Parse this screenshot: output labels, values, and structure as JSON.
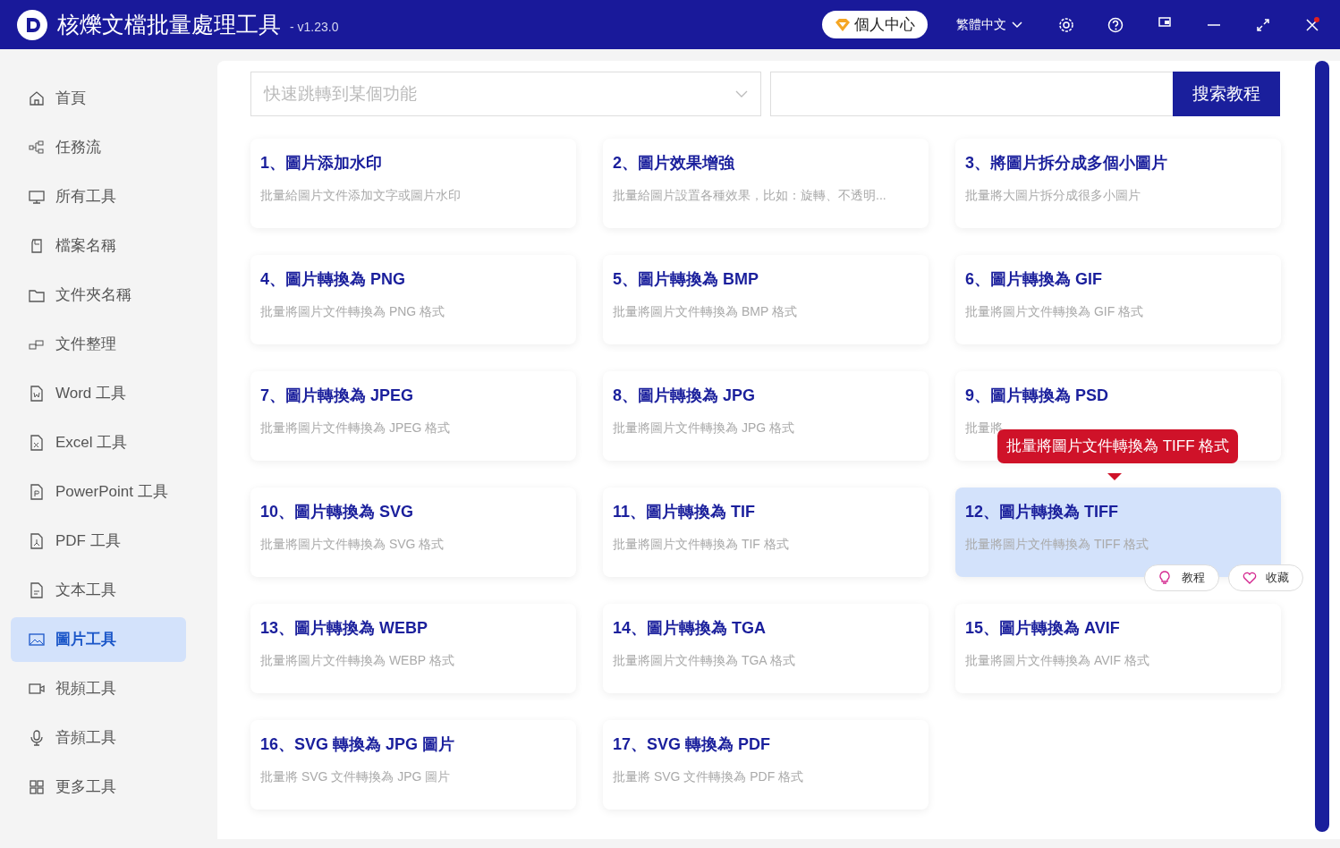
{
  "app": {
    "title": "核爍文檔批量處理工具",
    "version": "- v1.23.0"
  },
  "header": {
    "account_button": "個人中心",
    "language": "繁體中文"
  },
  "sidebar": {
    "items": [
      {
        "label": "首頁",
        "selected": false
      },
      {
        "label": "任務流",
        "selected": false
      },
      {
        "label": "所有工具",
        "selected": false
      },
      {
        "label": "檔案名稱",
        "selected": false
      },
      {
        "label": "文件夾名稱",
        "selected": false
      },
      {
        "label": "文件整理",
        "selected": false
      },
      {
        "label": "Word 工具",
        "selected": false
      },
      {
        "label": "Excel 工具",
        "selected": false
      },
      {
        "label": "PowerPoint 工具",
        "selected": false
      },
      {
        "label": "PDF 工具",
        "selected": false
      },
      {
        "label": "文本工具",
        "selected": false
      },
      {
        "label": "圖片工具",
        "selected": true
      },
      {
        "label": "視頻工具",
        "selected": false
      },
      {
        "label": "音頻工具",
        "selected": false
      },
      {
        "label": "更多工具",
        "selected": false
      }
    ]
  },
  "search": {
    "placeholder": "快速跳轉到某個功能",
    "button": "搜索教程"
  },
  "tools": [
    {
      "title": "1、圖片添加水印",
      "description": "批量給圖片文件添加文字或圖片水印",
      "selected": false
    },
    {
      "title": "2、圖片效果增強",
      "description": "批量給圖片設置各種效果，比如：旋轉、不透明...",
      "selected": false
    },
    {
      "title": "3、將圖片拆分成多個小圖片",
      "description": "批量將大圖片拆分成很多小圖片",
      "selected": false
    },
    {
      "title": "4、圖片轉換為 PNG",
      "description": "批量將圖片文件轉換為 PNG 格式",
      "selected": false
    },
    {
      "title": "5、圖片轉換為 BMP",
      "description": "批量將圖片文件轉換為 BMP 格式",
      "selected": false
    },
    {
      "title": "6、圖片轉換為 GIF",
      "description": "批量將圖片文件轉換為 GIF 格式",
      "selected": false
    },
    {
      "title": "7、圖片轉換為 JPEG",
      "description": "批量將圖片文件轉換為 JPEG 格式",
      "selected": false
    },
    {
      "title": "8、圖片轉換為 JPG",
      "description": "批量將圖片文件轉換為 JPG 格式",
      "selected": false
    },
    {
      "title": "9、圖片轉換為 PSD",
      "description": "批量將",
      "selected": false
    },
    {
      "title": "10、圖片轉換為 SVG",
      "description": "批量將圖片文件轉換為 SVG 格式",
      "selected": false
    },
    {
      "title": "11、圖片轉換為 TIF",
      "description": "批量將圖片文件轉換為 TIF 格式",
      "selected": false
    },
    {
      "title": "12、圖片轉換為 TIFF",
      "description": "批量將圖片文件轉換為 TIFF 格式",
      "selected": true,
      "actions": [
        "教程",
        "收藏"
      ]
    },
    {
      "title": "13、圖片轉換為 WEBP",
      "description": "批量將圖片文件轉換為 WEBP 格式",
      "selected": false
    },
    {
      "title": "14、圖片轉換為 TGA",
      "description": "批量將圖片文件轉換為 TGA 格式",
      "selected": false
    },
    {
      "title": "15、圖片轉換為 AVIF",
      "description": "批量將圖片文件轉換為 AVIF 格式",
      "selected": false
    },
    {
      "title": "16、SVG 轉換為 JPG 圖片",
      "description": "批量將 SVG 文件轉換為 JPG 圖片",
      "selected": false
    },
    {
      "title": "17、SVG 轉換為 PDF",
      "description": "批量將 SVG 文件轉換為 PDF 格式",
      "selected": false
    }
  ],
  "tooltip": "批量將圖片文件轉換為 TIFF 格式"
}
